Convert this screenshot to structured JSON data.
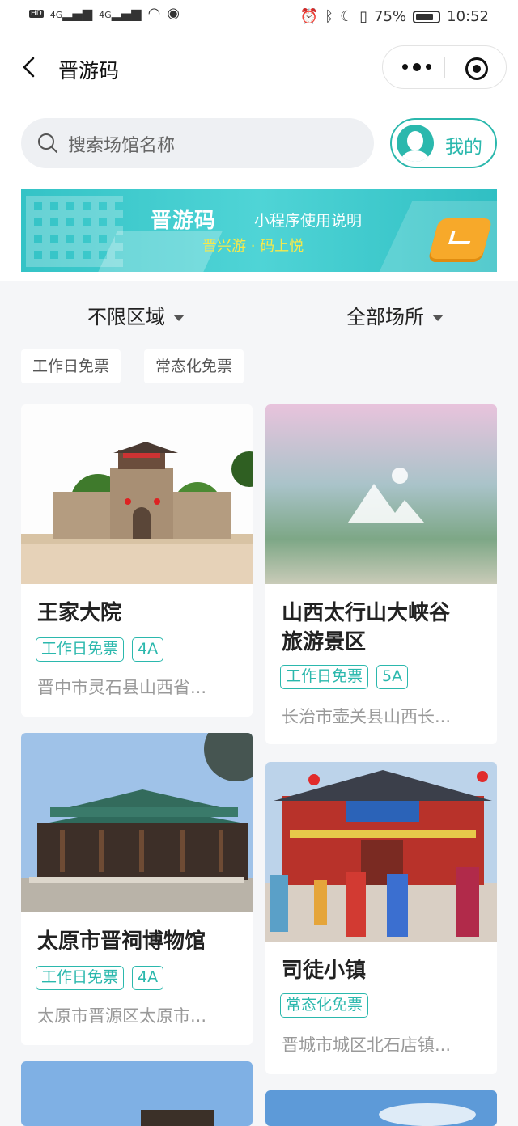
{
  "status_bar": {
    "left": "HD 4G 4G",
    "battery": "75%",
    "time": "10:52"
  },
  "nav": {
    "title": "晋游码"
  },
  "search": {
    "placeholder": "搜索场馆名称"
  },
  "mine": {
    "label": "我的"
  },
  "banner": {
    "title": "晋游码",
    "subtitle": "小程序使用说明",
    "tagline": "晋兴游 · 码上悦"
  },
  "filters": {
    "region": "不限区域",
    "venue": "全部场所"
  },
  "chips": [
    "工作日免票",
    "常态化免票"
  ],
  "cards": [
    {
      "name": "王家大院",
      "tags": [
        "工作日免票",
        "4A"
      ],
      "address": "晋中市灵石县山西省..."
    },
    {
      "name": "山西太行山大峡谷旅游景区",
      "name_line1": "山西太行山大峡谷",
      "name_line2": "旅游景区",
      "tags": [
        "工作日免票",
        "5A"
      ],
      "address": "长治市壶关县山西长..."
    },
    {
      "name": "太原市晋祠博物馆",
      "tags": [
        "工作日免票",
        "4A"
      ],
      "address": "太原市晋源区太原市..."
    },
    {
      "name": "司徒小镇",
      "tags": [
        "常态化免票"
      ],
      "address": "晋城市城区北石店镇..."
    }
  ]
}
